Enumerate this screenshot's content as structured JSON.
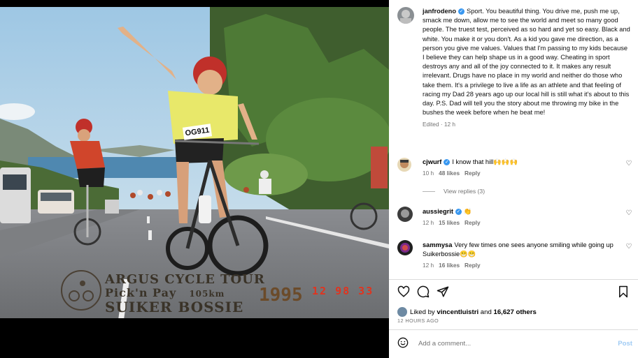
{
  "photo": {
    "brand_line1": "ARGUS CYCLE TOUR",
    "brand_line2": "Pick'n Pay",
    "brand_line2_distance": "105km",
    "brand_line3": "SUIKER BOSSIE",
    "year": "1995",
    "date_stamp": "12 98 33",
    "race_number": "OG911"
  },
  "post": {
    "author": "janfrodeno",
    "caption": "Sport. You beautiful thing. You drive me, push me up, smack me down, allow me to see the world and meet so many good people. The truest test, perceived as so hard and yet so easy. Black and white. You make it or you don't. As a kid you gave me direction, as a person you give me values. Values that I'm passing to my kids because I believe they can help shape us in a good way. Cheating in sport destroys any and all of the joy connected to it. It makes any result irrelevant. Drugs have no place in my world and neither do those who take them. It's a privilege to live a life as an athlete and that feeling of racing my Dad 28 years ago up our local hill is still what it's about to this day. P.S. Dad will tell you the story about me throwing my bike in the bushes the week before when he beat me!",
    "edited": "Edited · 12 h",
    "liked_by_prefix": "Liked by ",
    "liked_by_user": "vincentluistri",
    "liked_by_and": " and ",
    "liked_by_others": "16,627 others",
    "date": "12 HOURS AGO"
  },
  "comments": [
    {
      "user": "cjwurf",
      "verified": true,
      "text": "I know that hill🙌🙌🙌",
      "age": "10 h",
      "likes": "48 likes",
      "reply": "Reply"
    },
    {
      "user": "aussiegrit",
      "verified": true,
      "text": "👏",
      "age": "12 h",
      "likes": "15 likes",
      "reply": "Reply"
    },
    {
      "user": "sammysa",
      "verified": false,
      "text": "Very few times one sees anyone smiling while going up Suikerbossie😁😁",
      "age": "12 h",
      "likes": "16 likes",
      "reply": "Reply"
    }
  ],
  "view_replies": "View replies (3)",
  "compose": {
    "placeholder": "Add a comment...",
    "post_label": "Post"
  },
  "icons": [
    "heart-icon",
    "comment-icon",
    "share-icon",
    "bookmark-icon",
    "emoji-icon",
    "verified-icon"
  ],
  "colors": {
    "accent": "#3897f0",
    "post_disabled": "#9fcbf4",
    "meta": "#737373"
  }
}
